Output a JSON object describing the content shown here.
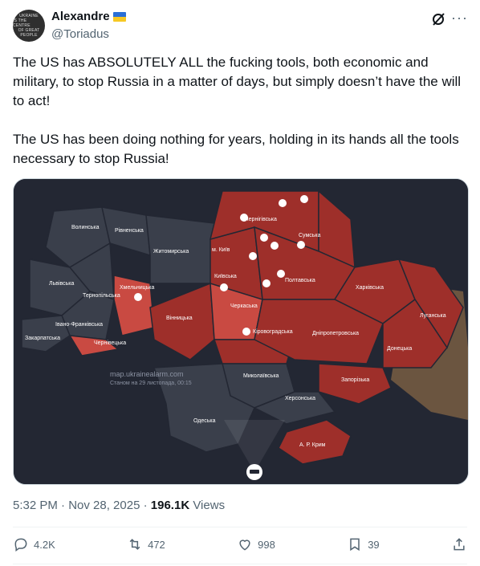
{
  "author": {
    "display_name": "Alexandre",
    "handle": "@Toriadus",
    "avatar_lines": [
      "UKRAINE",
      "IS THE CENTRE",
      "OF GREAT",
      "PEOPLE"
    ]
  },
  "tweet": {
    "paragraph_1": "The US has ABSOLUTELY ALL the fucking tools, both economic and military, to stop Russia in a matter of days, but simply doesn’t have the will to act!",
    "paragraph_2": "The US has been doing nothing for years, holding in its hands all the tools necessary to stop Russia!"
  },
  "map": {
    "watermark_site": "map.ukrainealarm.com",
    "watermark_date": "Станом на 29 листопада, 00:15",
    "oblasts": {
      "volynska": "Волинська",
      "rivnenska": "Рівненська",
      "zhytomyrska": "Житомирська",
      "chernihivska": "Чернігівська",
      "sumska": "Сумська",
      "kyiv": "м. Київ",
      "kyivska": "Київська",
      "poltavska": "Полтавська",
      "kharkivska": "Харківська",
      "luhanska": "Луганська",
      "lvivska": "Львівська",
      "ternopilska": "Тернопільська",
      "khmelnytska": "Хмельницька",
      "vinnytska": "Вінницька",
      "cherkaska": "Черкаська",
      "kirovohradska": "Кіровоградська",
      "dnipropetrovska": "Дніпропетровська",
      "donetska": "Донецька",
      "ivanofrankivska": "Івано-Франківська",
      "zakarpatska": "Закарпатська",
      "chernivetska": "Чернівецька",
      "mykolaivska": "Миколаївська",
      "zaporizka": "Запорізька",
      "khersonska": "Херсонська",
      "odeska": "Одеська",
      "krym": "А. Р. Крим"
    },
    "colors": {
      "alert": "#9e2f2a",
      "alert_light": "#c94a42",
      "calm": "#3a3f4b",
      "occupied": "#6b5540",
      "background": "#232733"
    }
  },
  "meta": {
    "time": "5:32 PM · Nov 28, 2025",
    "separator": "·",
    "views_count": "196.1K",
    "views_label": "Views"
  },
  "actions": {
    "replies": "4.2K",
    "reposts": "472",
    "likes": "998",
    "bookmarks": "39"
  },
  "icons": [
    "grok-icon",
    "more-icon",
    "reply-icon",
    "repost-icon",
    "like-icon",
    "bookmark-icon",
    "share-icon",
    "alert-icon",
    "ship-icon"
  ]
}
